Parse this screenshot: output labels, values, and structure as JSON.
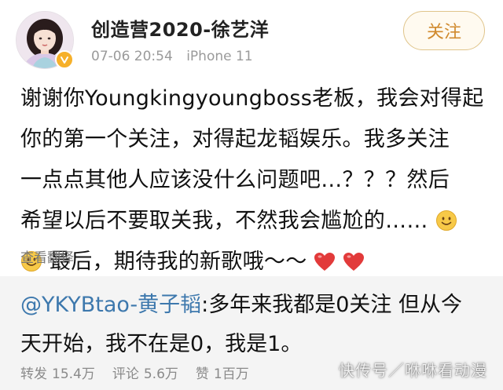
{
  "author": {
    "name": "创造营2020-徐艺洋",
    "time": "07-06 20:54",
    "device": "iPhone 11",
    "verified_color": "#f6b02a"
  },
  "follow_button": {
    "label": "关注"
  },
  "post": {
    "lines": [
      "谢谢你Youngkingyoungboss老板，我会对得起",
      "你的第一个关注，对得起龙韬娱乐。我多关注",
      "一点点其他人应该没什么问题吧…？？？然后",
      "希望以后不要取关我，不然我会尴尬的……",
      "最后，期待我的新歌哦～～"
    ],
    "emojis": [
      "smile-emoji",
      "smile-emoji",
      "heart-emoji",
      "heart-emoji"
    ]
  },
  "translate_label": "查看翻译",
  "repost": {
    "mention": "@YKYBtao-黄子韬",
    "text_line1": ":多年来我都是0关注 但从今",
    "text_line2": "天开始，我不在是0，我是1。"
  },
  "stats": {
    "repost_label": "转发",
    "repost_count": "15.4万",
    "comment_label": "评论",
    "comment_count": "5.6万",
    "like_label": "赞",
    "like_count": "1百万"
  },
  "watermark": "快传号／咻咻看动漫",
  "colors": {
    "accent_follow": "#d08a2e",
    "link": "#3d78ad",
    "repost_bg": "#f4f4f4"
  }
}
